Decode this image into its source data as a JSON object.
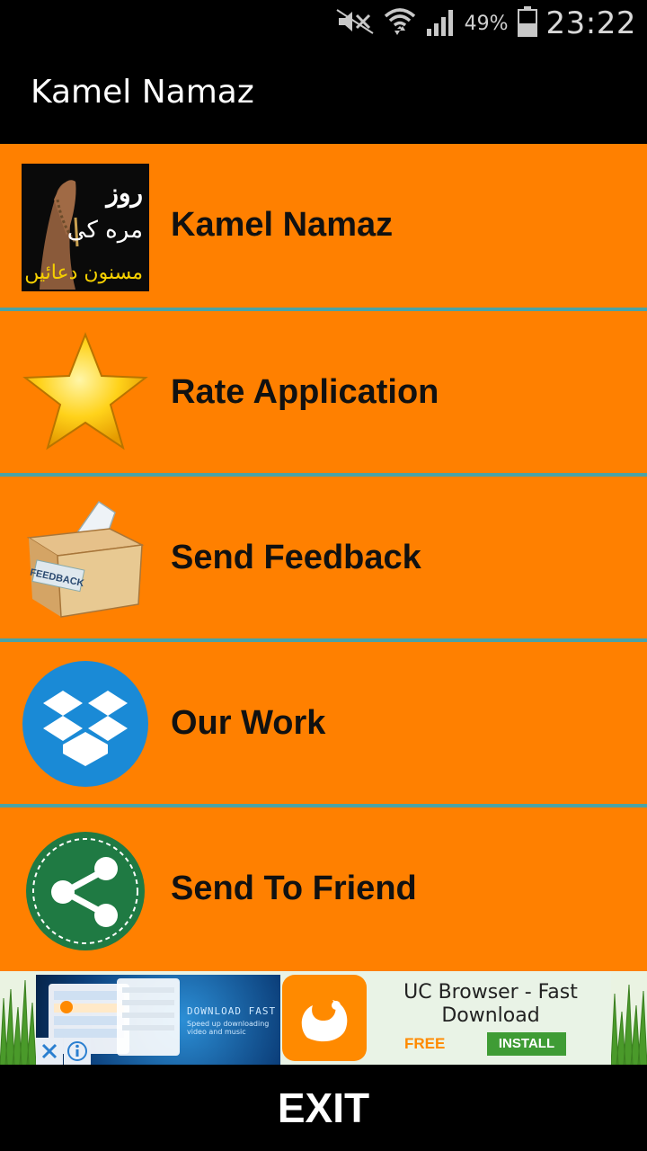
{
  "status_bar": {
    "battery_percent": "49%",
    "time": "23:22",
    "icons": [
      "mute-icon",
      "wifi-icon",
      "signal-icon",
      "battery-icon"
    ]
  },
  "app_bar": {
    "title": "Kamel Namaz"
  },
  "menu": {
    "items": [
      {
        "label": "Kamel Namaz",
        "icon": "prayer-hands-thumbnail"
      },
      {
        "label": "Rate Application",
        "icon": "star-icon"
      },
      {
        "label": "Send Feedback",
        "icon": "feedback-box-icon"
      },
      {
        "label": "Our Work",
        "icon": "dropbox-icon"
      },
      {
        "label": "Send To Friend",
        "icon": "share-icon"
      }
    ],
    "background_color": "#ff8000",
    "divider_color": "#4aa3a6"
  },
  "ad": {
    "title": "UC Browser - Fast Download",
    "price": "FREE",
    "install_label": "INSTALL",
    "banner_text": "DOWNLOAD FAST",
    "banner_sub": "Speed up downloading video and music"
  },
  "exit": {
    "label": "EXIT"
  }
}
